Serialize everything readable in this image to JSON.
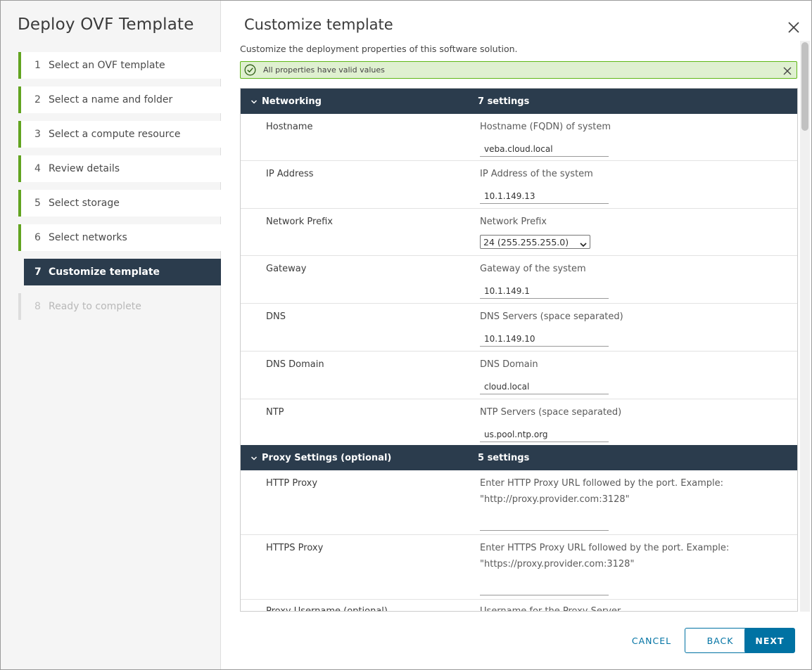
{
  "wizard": {
    "title": "Deploy OVF Template",
    "steps": [
      {
        "num": "1",
        "label": "Select an OVF template"
      },
      {
        "num": "2",
        "label": "Select a name and folder"
      },
      {
        "num": "3",
        "label": "Select a compute resource"
      },
      {
        "num": "4",
        "label": "Review details"
      },
      {
        "num": "5",
        "label": "Select storage"
      },
      {
        "num": "6",
        "label": "Select networks"
      },
      {
        "num": "7",
        "label": "Customize template"
      },
      {
        "num": "8",
        "label": "Ready to complete"
      }
    ]
  },
  "page": {
    "title": "Customize template",
    "subtitle": "Customize the deployment properties of this software solution."
  },
  "alert": {
    "text": "All properties have valid values",
    "color": "#5eb715"
  },
  "sections": [
    {
      "name": "Networking",
      "count": "7 settings",
      "rows": [
        {
          "label": "Hostname",
          "desc": "Hostname (FQDN) of system",
          "value": "veba.cloud.local"
        },
        {
          "label": "IP Address",
          "desc": "IP Address of the system",
          "value": "10.1.149.13"
        },
        {
          "label": "Network Prefix",
          "desc": "Network Prefix",
          "selected": "24 (255.255.255.0)"
        },
        {
          "label": "Gateway",
          "desc": "Gateway of the system",
          "value": "10.1.149.1"
        },
        {
          "label": "DNS",
          "desc": "DNS Servers (space separated)",
          "value": "10.1.149.10"
        },
        {
          "label": "DNS Domain",
          "desc": "DNS Domain",
          "value": "cloud.local"
        },
        {
          "label": "NTP",
          "desc": "NTP Servers (space separated)",
          "value": "us.pool.ntp.org"
        }
      ]
    },
    {
      "name": "Proxy Settings (optional)",
      "count": "5 settings",
      "rows": [
        {
          "label": "HTTP Proxy",
          "desc": "Enter HTTP Proxy URL followed by the port. Example: \"http://proxy.provider.com:3128\"",
          "value": ""
        },
        {
          "label": "HTTPS Proxy",
          "desc": "Enter HTTPS Proxy URL followed by the port. Example: \"https://proxy.provider.com:3128\"",
          "value": ""
        },
        {
          "label": "Proxy Username (optional)",
          "desc": "Username for the Proxy Server"
        }
      ]
    }
  ],
  "footer": {
    "cancel": "CANCEL",
    "back": "BACK",
    "next": "NEXT"
  },
  "colors": {
    "accent": "#0072a3",
    "header_bg": "#2b3c4d",
    "step_complete": "#62a420"
  }
}
